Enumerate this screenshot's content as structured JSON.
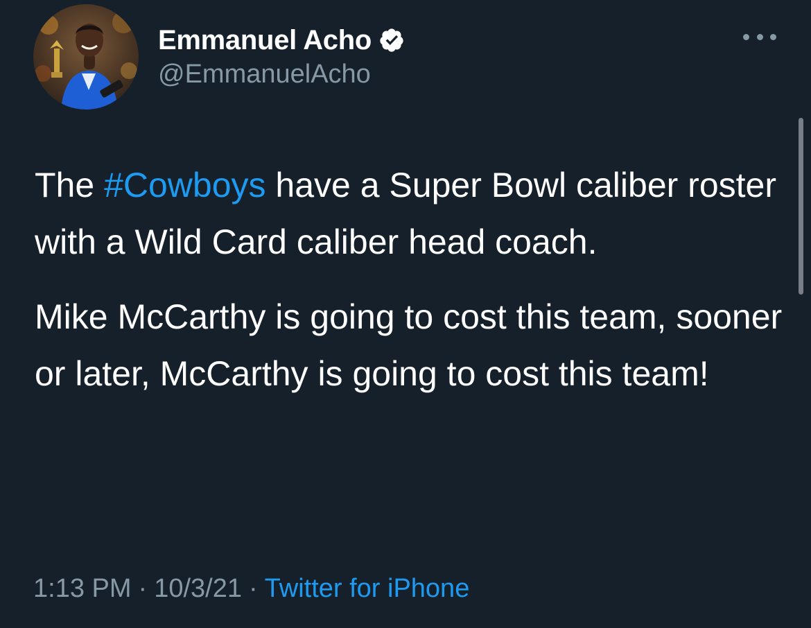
{
  "tweet": {
    "author": {
      "display_name": "Emmanuel Acho",
      "handle": "@EmmanuelAcho",
      "verified_icon": "verified-badge-icon",
      "avatar_icon": "profile-photo"
    },
    "more_icon": "more-options-icon",
    "text": {
      "p1_before": "The ",
      "p1_hashtag": "#Cowboys",
      "p1_after": " have a Super Bowl caliber roster with a Wild Card caliber head coach.",
      "p2": "Mike McCarthy is going to cost this team, sooner or later, McCarthy is going to cost this team!"
    },
    "meta": {
      "time": "1:13 PM",
      "date": "10/3/21",
      "separator": "·",
      "source": "Twitter for iPhone"
    }
  },
  "colors": {
    "background": "#15202b",
    "primary_text": "#ffffff",
    "secondary_text": "#8899a6",
    "accent": "#1d9bf0"
  }
}
